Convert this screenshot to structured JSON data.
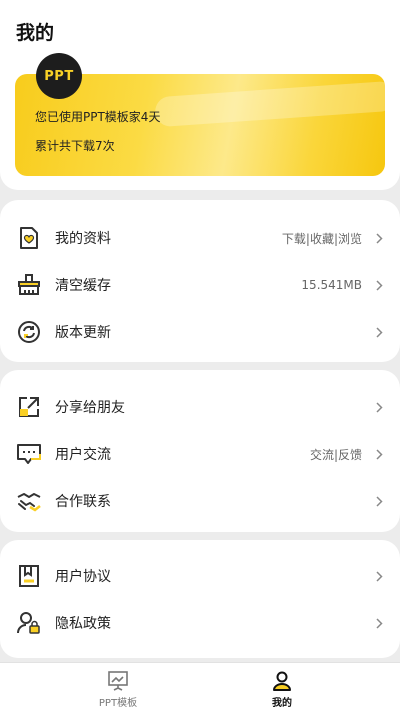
{
  "header": {
    "title": "我的",
    "logo_text": "PPT",
    "usage_text": "您已使用PPT模板家4天",
    "download_text": "累计共下载7次"
  },
  "group1": [
    {
      "label": "我的资料",
      "value": "下载|收藏|浏览",
      "icon": "document-heart-icon"
    },
    {
      "label": "清空缓存",
      "value": "15.541MB",
      "icon": "broom-icon"
    },
    {
      "label": "版本更新",
      "value": "",
      "icon": "refresh-icon"
    }
  ],
  "group2": [
    {
      "label": "分享给朋友",
      "value": "",
      "icon": "share-icon"
    },
    {
      "label": "用户交流",
      "value": "交流|反馈",
      "icon": "chat-icon"
    },
    {
      "label": "合作联系",
      "value": "",
      "icon": "handshake-icon"
    }
  ],
  "group3": [
    {
      "label": "用户协议",
      "value": "",
      "icon": "agreement-icon"
    },
    {
      "label": "隐私政策",
      "value": "",
      "icon": "privacy-user-icon"
    }
  ],
  "tabs": [
    {
      "label": "PPT模板",
      "icon": "presentation-icon",
      "active": false
    },
    {
      "label": "我的",
      "icon": "user-icon",
      "active": true
    }
  ],
  "colors": {
    "accent": "#f9cf24",
    "text": "#222222",
    "muted": "#666666",
    "tab_inactive": "#777777",
    "tab_active": "#111111"
  }
}
